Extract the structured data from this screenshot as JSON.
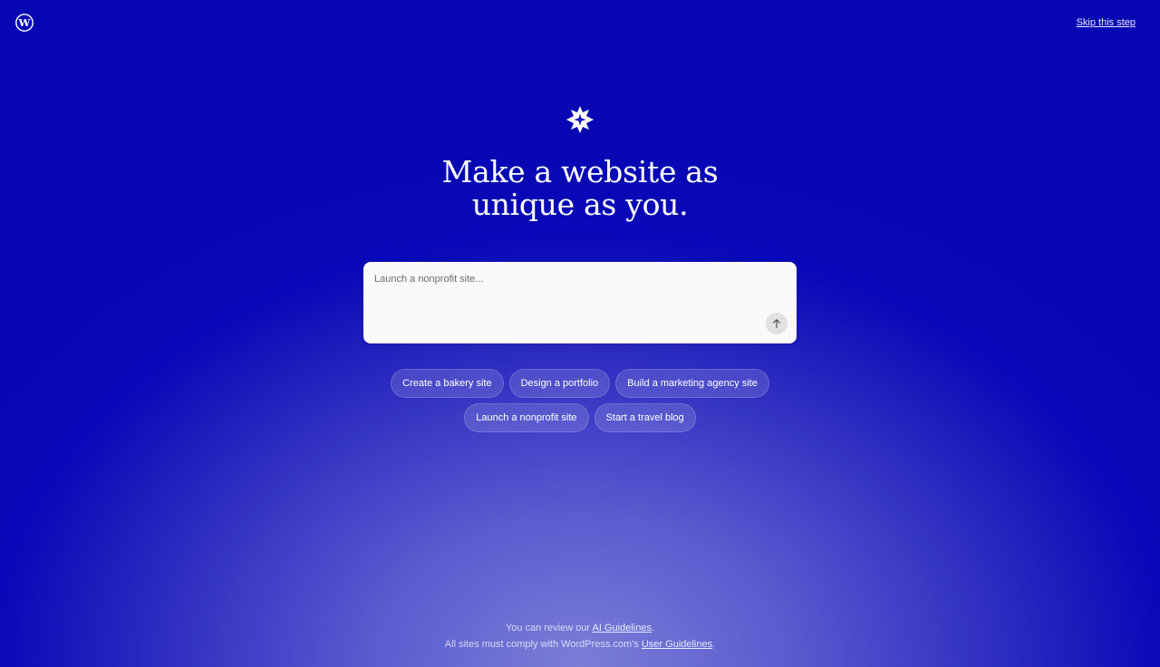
{
  "header": {
    "logo_icon": "wordpress-logo-icon",
    "skip_label": "Skip this step"
  },
  "hero": {
    "icon": "sparkle-star-icon",
    "headline_line1": "Make a website as",
    "headline_line2": "unique as you."
  },
  "prompt": {
    "placeholder": "Launch a nonprofit site...",
    "value": "",
    "send_icon": "arrow-up-icon"
  },
  "suggestions": {
    "row1": [
      "Create a bakery site",
      "Design a portfolio",
      "Build a marketing agency site"
    ],
    "row2": [
      "Launch a nonprofit site",
      "Start a travel blog"
    ]
  },
  "footer": {
    "line1_prefix": "You can review our ",
    "line1_link": "AI Guidelines",
    "line1_suffix": ".",
    "line2_prefix": "All sites must comply with WordPress.com's ",
    "line2_link": "User Guidelines",
    "line2_suffix": "."
  },
  "colors": {
    "background_top": "#0708b4",
    "background_glow": "#7a7ed6",
    "prompt_bg": "#fafafa",
    "text": "#ffffff"
  }
}
